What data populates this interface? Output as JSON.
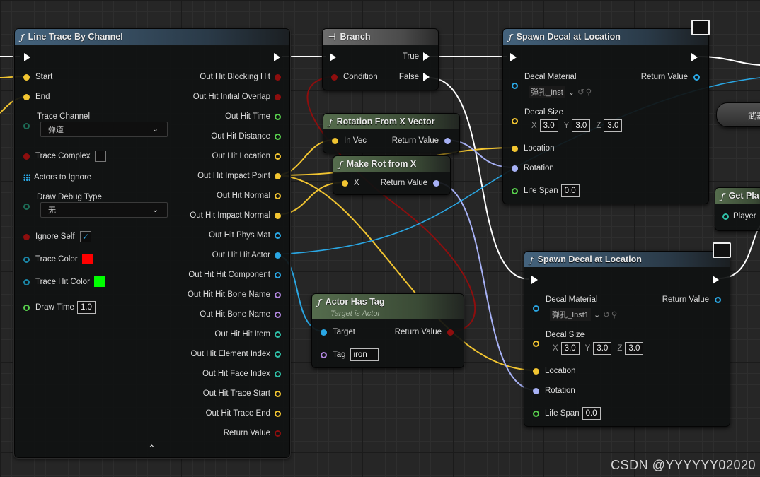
{
  "colors": {
    "exec": "#ffffff",
    "bool": "#8e0e0e",
    "float": "#58d04d",
    "vector": "#f2c531",
    "rotator": "#a7b1f5",
    "object": "#2aa7e4",
    "struct": "#1a86a7",
    "name": "#b287e0",
    "int": "#2fbfa7",
    "byte": "#1c6d57"
  },
  "trace": {
    "title": "Line Trace By Channel",
    "inputs": {
      "start": "Start",
      "end": "End",
      "trace_channel": "Trace Channel",
      "trace_channel_value": "弹道",
      "trace_complex": "Trace Complex",
      "actors_to_ignore": "Actors to Ignore",
      "draw_debug_type": "Draw Debug Type",
      "draw_debug_value": "无",
      "ignore_self": "Ignore Self",
      "trace_color": "Trace Color",
      "trace_hit_color": "Trace Hit Color",
      "draw_time": "Draw Time",
      "draw_time_value": "1.0"
    },
    "outputs": [
      "Out Hit Blocking Hit",
      "Out Hit Initial Overlap",
      "Out Hit Time",
      "Out Hit Distance",
      "Out Hit Location",
      "Out Hit Impact Point",
      "Out Hit Normal",
      "Out Hit Impact Normal",
      "Out Hit Phys Mat",
      "Out Hit Hit Actor",
      "Out Hit Hit Component",
      "Out Hit Hit Bone Name",
      "Out Hit Bone Name",
      "Out Hit Hit Item",
      "Out Hit Element Index",
      "Out Hit Face Index",
      "Out Hit Trace Start",
      "Out Hit Trace End",
      "Return Value"
    ],
    "expand_icon": "chevron-up-icon"
  },
  "branch": {
    "title": "Branch",
    "condition": "Condition",
    "true_label": "True",
    "false_label": "False"
  },
  "rotx": {
    "title": "Rotation From X Vector",
    "in": "In Vec",
    "out": "Return Value"
  },
  "makerot": {
    "title": "Make Rot from X",
    "in": "X",
    "out": "Return Value"
  },
  "hastag": {
    "title": "Actor Has Tag",
    "subtitle": "Target is Actor",
    "target": "Target",
    "tag": "Tag",
    "tag_value": "iron",
    "out": "Return Value"
  },
  "spawn1": {
    "title": "Spawn Decal at Location",
    "decal_material": "Decal Material",
    "material_value": "弹孔_Inst",
    "return_value": "Return Value",
    "decal_size": "Decal Size",
    "x": "3.0",
    "y": "3.0",
    "z": "3.0",
    "location": "Location",
    "rotation": "Rotation",
    "life_span": "Life Span",
    "life_value": "0.0"
  },
  "spawn2": {
    "title": "Spawn Decal at Location",
    "decal_material": "Decal Material",
    "material_value": "弹孔_Inst1",
    "return_value": "Return Value",
    "decal_size": "Decal Size",
    "x": "3.0",
    "y": "3.0",
    "z": "3.0",
    "location": "Location",
    "rotation": "Rotation",
    "life_span": "Life Span",
    "life_value": "0.0"
  },
  "weapon_node": {
    "label": "武器"
  },
  "getplayer": {
    "title": "Get Pla",
    "pin": "Player"
  },
  "axis": {
    "x": "X",
    "y": "Y",
    "z": "Z"
  },
  "watermark": "CSDN @YYYYYY02020"
}
